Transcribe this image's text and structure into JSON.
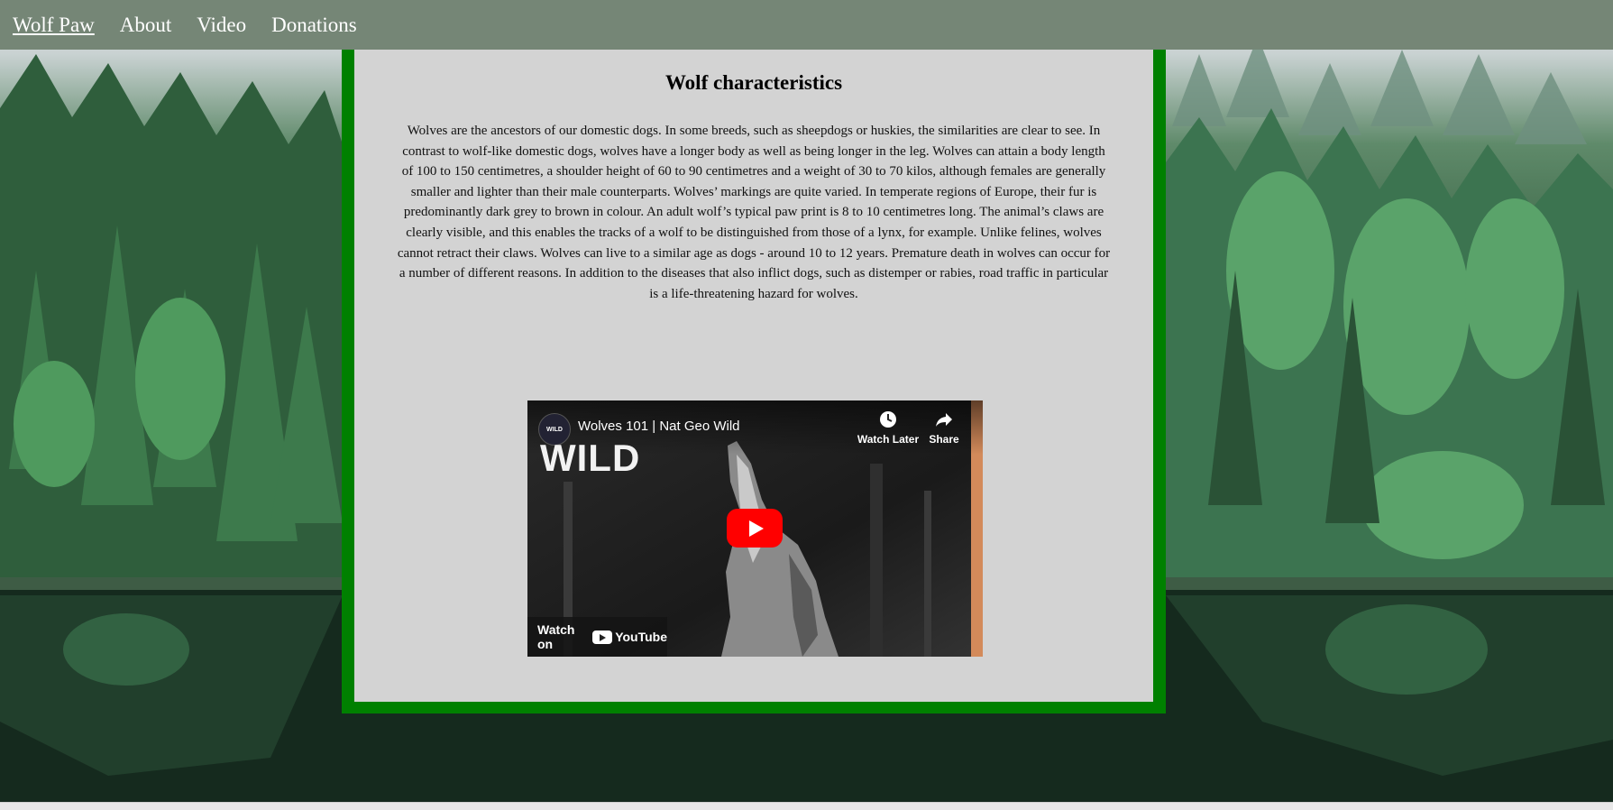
{
  "nav": {
    "items": [
      {
        "label": "Wolf Paw"
      },
      {
        "label": "About"
      },
      {
        "label": "Video"
      },
      {
        "label": "Donations"
      }
    ]
  },
  "article": {
    "title": "Wolf characteristics",
    "text": "Wolves are the ancestors of our domestic dogs. In some breeds, such as sheepdogs or huskies, the similarities are clear to see. In contrast to wolf-like domestic dogs, wolves have a longer body as well as being longer in the leg. Wolves can attain a body length of 100 to 150 centimetres, a shoulder height of 60 to 90 centimetres and a weight of 30 to 70 kilos, although females are generally smaller and lighter than their male counterparts. Wolves’ markings are quite varied. In temperate regions of Europe, their fur is predominantly dark grey to brown in colour. An adult wolf’s typical paw print is 8 to 10 centimetres long. The animal’s claws are clearly visible, and this enables the tracks of a wolf to be distinguished from those of a lynx, for example. Unlike felines, wolves cannot retract their claws. Wolves can live to a similar age as dogs - around 10 to 12 years. Premature death in wolves can occur for a number of different reasons. In addition to the diseases that also inflict dogs, such as distemper or rabies, road traffic in particular is a life-threatening hazard for wolves."
  },
  "video": {
    "title": "Wolves 101 | Nat Geo Wild",
    "channel_logo": "WILD",
    "overlay_text": "WILD",
    "watch_later": "Watch Later",
    "share": "Share",
    "watch_on": "Watch on",
    "youtube": "YouTube"
  },
  "colors": {
    "navbar": "#758676",
    "panel_border": "#008000",
    "panel_bg": "#d3d3d3",
    "play_button": "#ff0000"
  }
}
